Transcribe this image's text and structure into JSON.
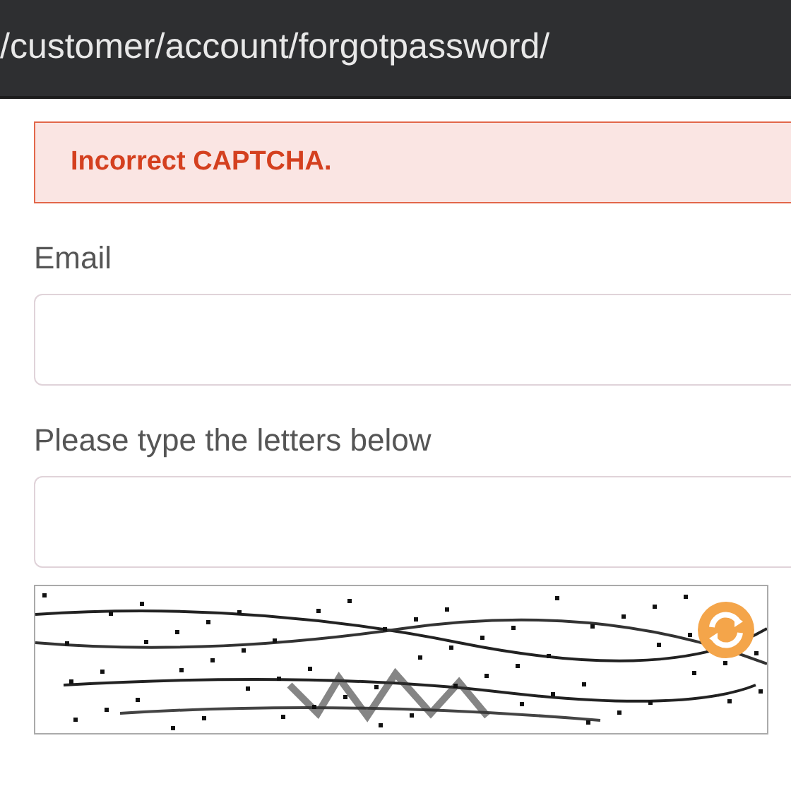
{
  "address_bar": {
    "url": "/customer/account/forgotpassword/"
  },
  "error_message": {
    "text": "Incorrect CAPTCHA."
  },
  "fields": [
    {
      "label": "Email"
    },
    {
      "label": "Please type the letters below"
    }
  ]
}
